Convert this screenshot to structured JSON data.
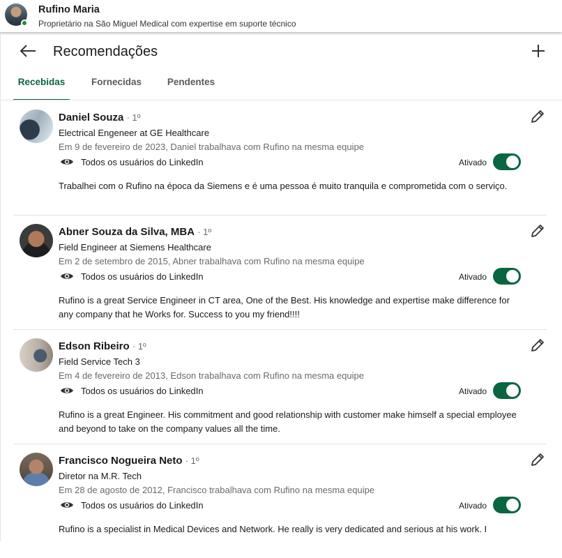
{
  "profile": {
    "name": "Rufino Maria",
    "headline": "Proprietário na São Miguel Medical com expertise em suporte técnico"
  },
  "page": {
    "title": "Recomendações",
    "back_icon": "arrow-left-icon",
    "add_icon": "plus-icon"
  },
  "tabs": [
    {
      "label": "Recebidas",
      "active": true
    },
    {
      "label": "Fornecidas",
      "active": false
    },
    {
      "label": "Pendentes",
      "active": false
    }
  ],
  "recommendations": [
    {
      "name": "Daniel Souza",
      "degree": "· 1º",
      "title": "Electrical Engeneer at GE Healthcare",
      "meta": "Em 9 de fevereiro de 2023, Daniel trabalhava com Rufino na mesma equipe",
      "visibility": "Todos os usuários do LinkedIn",
      "toggle_label": "Ativado",
      "text": "Trabalhei com o Rufino na época da Siemens e é uma pessoa é muito tranquila e comprometida com o serviço."
    },
    {
      "name": "Abner Souza da Silva, MBA",
      "degree": "· 1º",
      "title": "Field Engineer at Siemens Healthcare",
      "meta": "Em 2 de setembro de 2015, Abner trabalhava com Rufino na mesma equipe",
      "visibility": "Todos os usuários do LinkedIn",
      "toggle_label": "Ativado",
      "text": "Rufino is a great Service Engineer in CT area, One of the Best. His knowledge and expertise make difference for any company that he Works for. Success to you my friend!!!!"
    },
    {
      "name": "Edson Ribeiro",
      "degree": "· 1º",
      "title": "Field Service Tech 3",
      "meta": "Em 4 de fevereiro de 2013, Edson trabalhava com Rufino na mesma equipe",
      "visibility": "Todos os usuários do LinkedIn",
      "toggle_label": "Ativado",
      "text": "Rufino is a great Engineer. His commitment and good relationship with customer make himself a special employee and beyond to take on the company values all the time."
    },
    {
      "name": "Francisco Nogueira Neto",
      "degree": "· 1º",
      "title": "Diretor na M.R. Tech",
      "meta": "Em 28 de agosto de 2012, Francisco trabalhava com Rufino na mesma equipe",
      "visibility": "Todos os usuários do LinkedIn",
      "toggle_label": "Ativado",
      "text": "Rufino is a specialist in Medical Devices and Network. He really is very dedicated and serious at his work. I"
    }
  ],
  "colors": {
    "accent": "#0a6640",
    "status_online": "#1f8a43"
  }
}
